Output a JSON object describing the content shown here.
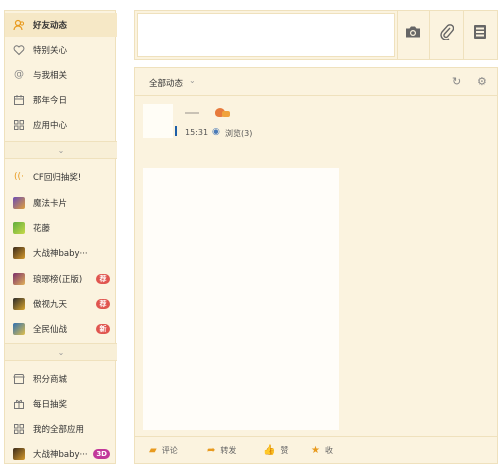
{
  "sidebar": {
    "nav": [
      {
        "icon": "friends-icon",
        "label": "好友动态",
        "active": true
      },
      {
        "icon": "heart-icon",
        "label": "特别关心"
      },
      {
        "icon": "at-icon",
        "label": "与我相关"
      },
      {
        "icon": "calendar-icon",
        "label": "那年今日"
      },
      {
        "icon": "apps-icon",
        "label": "应用中心"
      }
    ],
    "games": [
      {
        "icon": "broadcast-icon",
        "label": "CF回归抽奖!"
      },
      {
        "icon": "magic-card-icon",
        "label": "魔法卡片"
      },
      {
        "icon": "garden-icon",
        "label": "花藤"
      },
      {
        "icon": "game-icon",
        "label": "大战神baby···"
      },
      {
        "icon": "game-icon",
        "label": "琅琊榜(正版)",
        "badge": "荐"
      },
      {
        "icon": "game-icon",
        "label": "傲视九天",
        "badge": "荐"
      },
      {
        "icon": "game-icon",
        "label": "全民仙战",
        "badge": "新"
      }
    ],
    "extras": [
      {
        "icon": "store-icon",
        "label": "积分商城"
      },
      {
        "icon": "gift-icon",
        "label": "每日抽奖"
      },
      {
        "icon": "apps-icon",
        "label": "我的全部应用"
      },
      {
        "icon": "game-icon",
        "label": "大战神baby···",
        "badge": "3D"
      }
    ]
  },
  "publish": {
    "buttons": [
      "camera-icon",
      "attachment-icon",
      "more-icon"
    ]
  },
  "feed": {
    "title": "全部动态",
    "post": {
      "time": "15:31",
      "views": "浏览(3)"
    },
    "actions": {
      "comment": "评论",
      "forward": "转发",
      "like": "赞",
      "favorite": "收"
    }
  },
  "colors": {
    "panel_bg": "#fbf3df",
    "border": "#efe1bd",
    "accent": "#e89a1e",
    "badge": "#e0554f"
  }
}
